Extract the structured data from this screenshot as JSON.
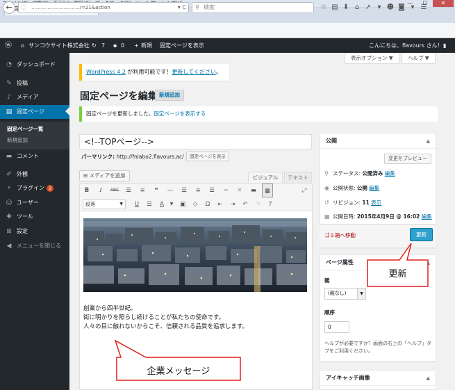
{
  "browser": {
    "menu": [
      "ファイル(F)",
      "編集(E)",
      "表示(V)",
      "履歴(S)",
      "ブックマーク(B)",
      "ツール(T)",
      "ヘルプ(H)"
    ],
    "tab_title": "固定ページを編集 ‹ サンコウサイ…",
    "new_tab": "+",
    "url": "…………………………i=21&action",
    "search_placeholder": "検索",
    "window_controls": {
      "minimize": "—",
      "maximize": "☐",
      "close": "✕"
    }
  },
  "adminbar": {
    "site_name": "サンコウサイト株式会社",
    "updates_count": "7",
    "comments_count": "0",
    "new_label": "新規",
    "view_page": "固定ページを表示",
    "greeting": "こんにちは、flavours さん！"
  },
  "sidebar": {
    "items": [
      {
        "label": "ダッシュボード",
        "icon": "dashboard-icon"
      },
      {
        "label": "投稿",
        "icon": "pin-icon"
      },
      {
        "label": "メディア",
        "icon": "media-icon"
      },
      {
        "label": "固定ページ",
        "icon": "page-icon"
      },
      {
        "label": "コメント",
        "icon": "comment-icon"
      },
      {
        "label": "外観",
        "icon": "brush-icon"
      },
      {
        "label": "プラグイン",
        "icon": "plugin-icon",
        "badge": "2"
      },
      {
        "label": "ユーザー",
        "icon": "user-icon"
      },
      {
        "label": "ツール",
        "icon": "wrench-icon"
      },
      {
        "label": "設定",
        "icon": "settings-icon"
      },
      {
        "label": "メニューを閉じる",
        "icon": "collapse-icon"
      }
    ],
    "submenu": [
      "固定ページ一覧",
      "新規追加"
    ]
  },
  "screen": {
    "screen_options": "表示オプション ▼",
    "help": "ヘルプ ▼"
  },
  "update_nag": {
    "version": "WordPress 4.2",
    "text": " が利用可能です！",
    "link": "更新してください",
    "end": "。"
  },
  "page": {
    "title": "固定ページを編集",
    "add_new": "新規追加"
  },
  "notice": {
    "text": "固定ページを更新しました。",
    "link": "固定ページを表示する"
  },
  "post": {
    "title": "<!--TOPページ-->",
    "permalink_label": "パーマリンク:",
    "permalink_url": "http://fnlabo2.flavours.ac/",
    "permalink_button": "固定ページを表示"
  },
  "editor": {
    "media_button": "メディアを追加",
    "tab_visual": "ビジュアル",
    "tab_text": "テキスト",
    "format": "段落",
    "content_lines": [
      "創業から四半世紀。",
      "街に明かりを照らし続けることが私たちの使命です。",
      "人々の目に触れないからこそ、信頼される品質を追求します。"
    ]
  },
  "publish": {
    "title": "公開",
    "preview": "変更をプレビュー",
    "status_label": "ステータス: ",
    "status_value": "公開済み",
    "visibility_label": "公開状態: ",
    "visibility_value": "公開",
    "revisions_label": "リビジョン: ",
    "revisions_value": "11",
    "revisions_link": "表示",
    "date_label": "公開日時: ",
    "date_value": "2015年4月9日 @ 16:02",
    "edit": "編集",
    "trash": "ゴミ箱へ移動",
    "update": "更新"
  },
  "page_attributes": {
    "title": "ページ属性",
    "parent_label": "親",
    "parent_value": "(親なし)",
    "order_label": "順序",
    "order_value": "0",
    "help": "ヘルプが必要ですか？画面の右上の「ヘルプ」タブをご利用ください。"
  },
  "featured_image": {
    "title": "アイキャッチ画像"
  },
  "callouts": {
    "update": "更新",
    "message": "企業メッセージ"
  },
  "colors": {
    "admin_dark": "#23282d",
    "accent_blue": "#0073aa",
    "update_button": "#2ea2cc",
    "callout_border": "#e0201b"
  }
}
